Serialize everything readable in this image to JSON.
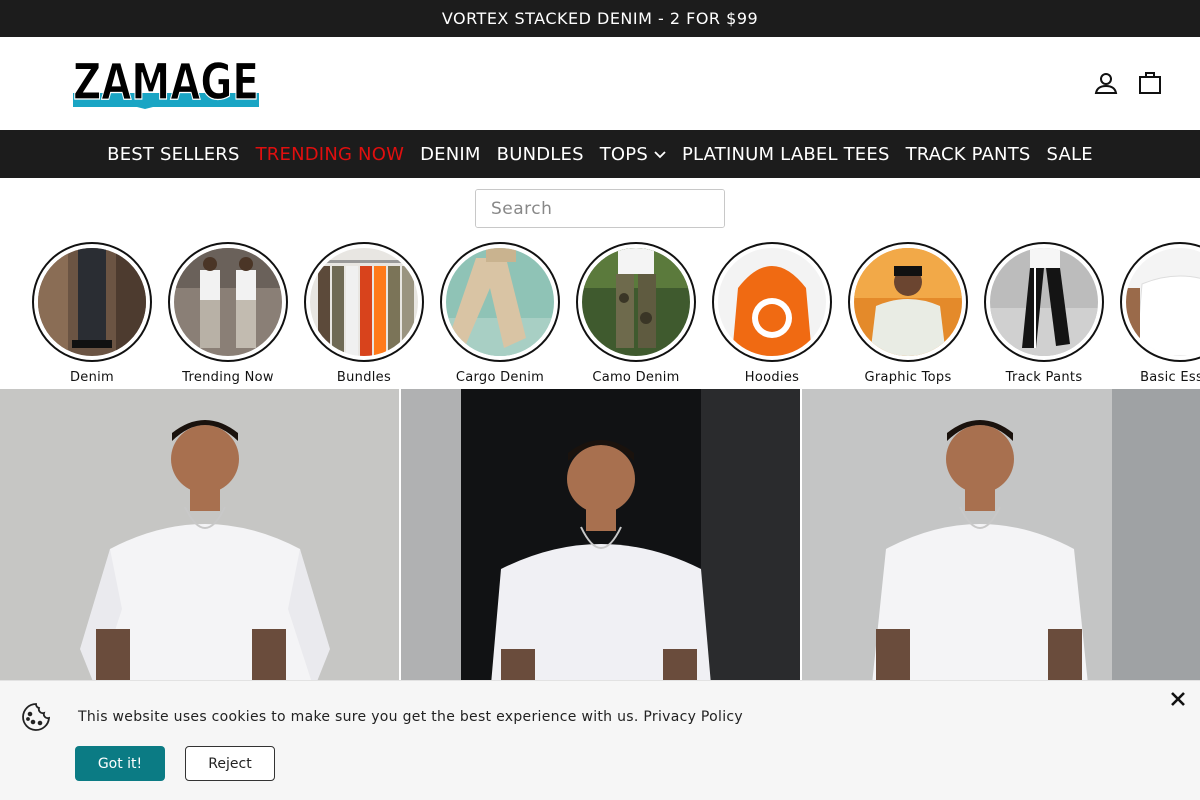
{
  "announcement": {
    "text": "VORTEX STACKED DENIM - 2 FOR $99"
  },
  "brand": {
    "logo_text": "ZAMAGE",
    "accent_color": "#1aa5c4"
  },
  "header": {
    "account_icon": "user-icon",
    "cart_icon": "bag-icon"
  },
  "nav": {
    "items": [
      {
        "label": "BEST SELLERS"
      },
      {
        "label": "TRENDING NOW",
        "highlight_color": "#e00f0f"
      },
      {
        "label": "DENIM"
      },
      {
        "label": "BUNDLES"
      },
      {
        "label": "TOPS",
        "has_dropdown": true
      },
      {
        "label": "PLATINUM LABEL TEES"
      },
      {
        "label": "TRACK PANTS"
      },
      {
        "label": "SALE"
      }
    ]
  },
  "search": {
    "placeholder": "Search",
    "value": "",
    "icon": "search-icon"
  },
  "categories": [
    {
      "label": "Denim"
    },
    {
      "label": "Trending Now"
    },
    {
      "label": "Bundles"
    },
    {
      "label": "Cargo Denim"
    },
    {
      "label": "Camo Denim"
    },
    {
      "label": "Hoodies"
    },
    {
      "label": "Graphic Tops"
    },
    {
      "label": "Track Pants"
    },
    {
      "label": "Basic Essen"
    }
  ],
  "cookie": {
    "message": "This website uses cookies to make sure you get the best experience with us.",
    "policy_link": "Privacy Policy",
    "accept_label": "Got it!",
    "reject_label": "Reject",
    "accept_color": "#0b7b84"
  }
}
